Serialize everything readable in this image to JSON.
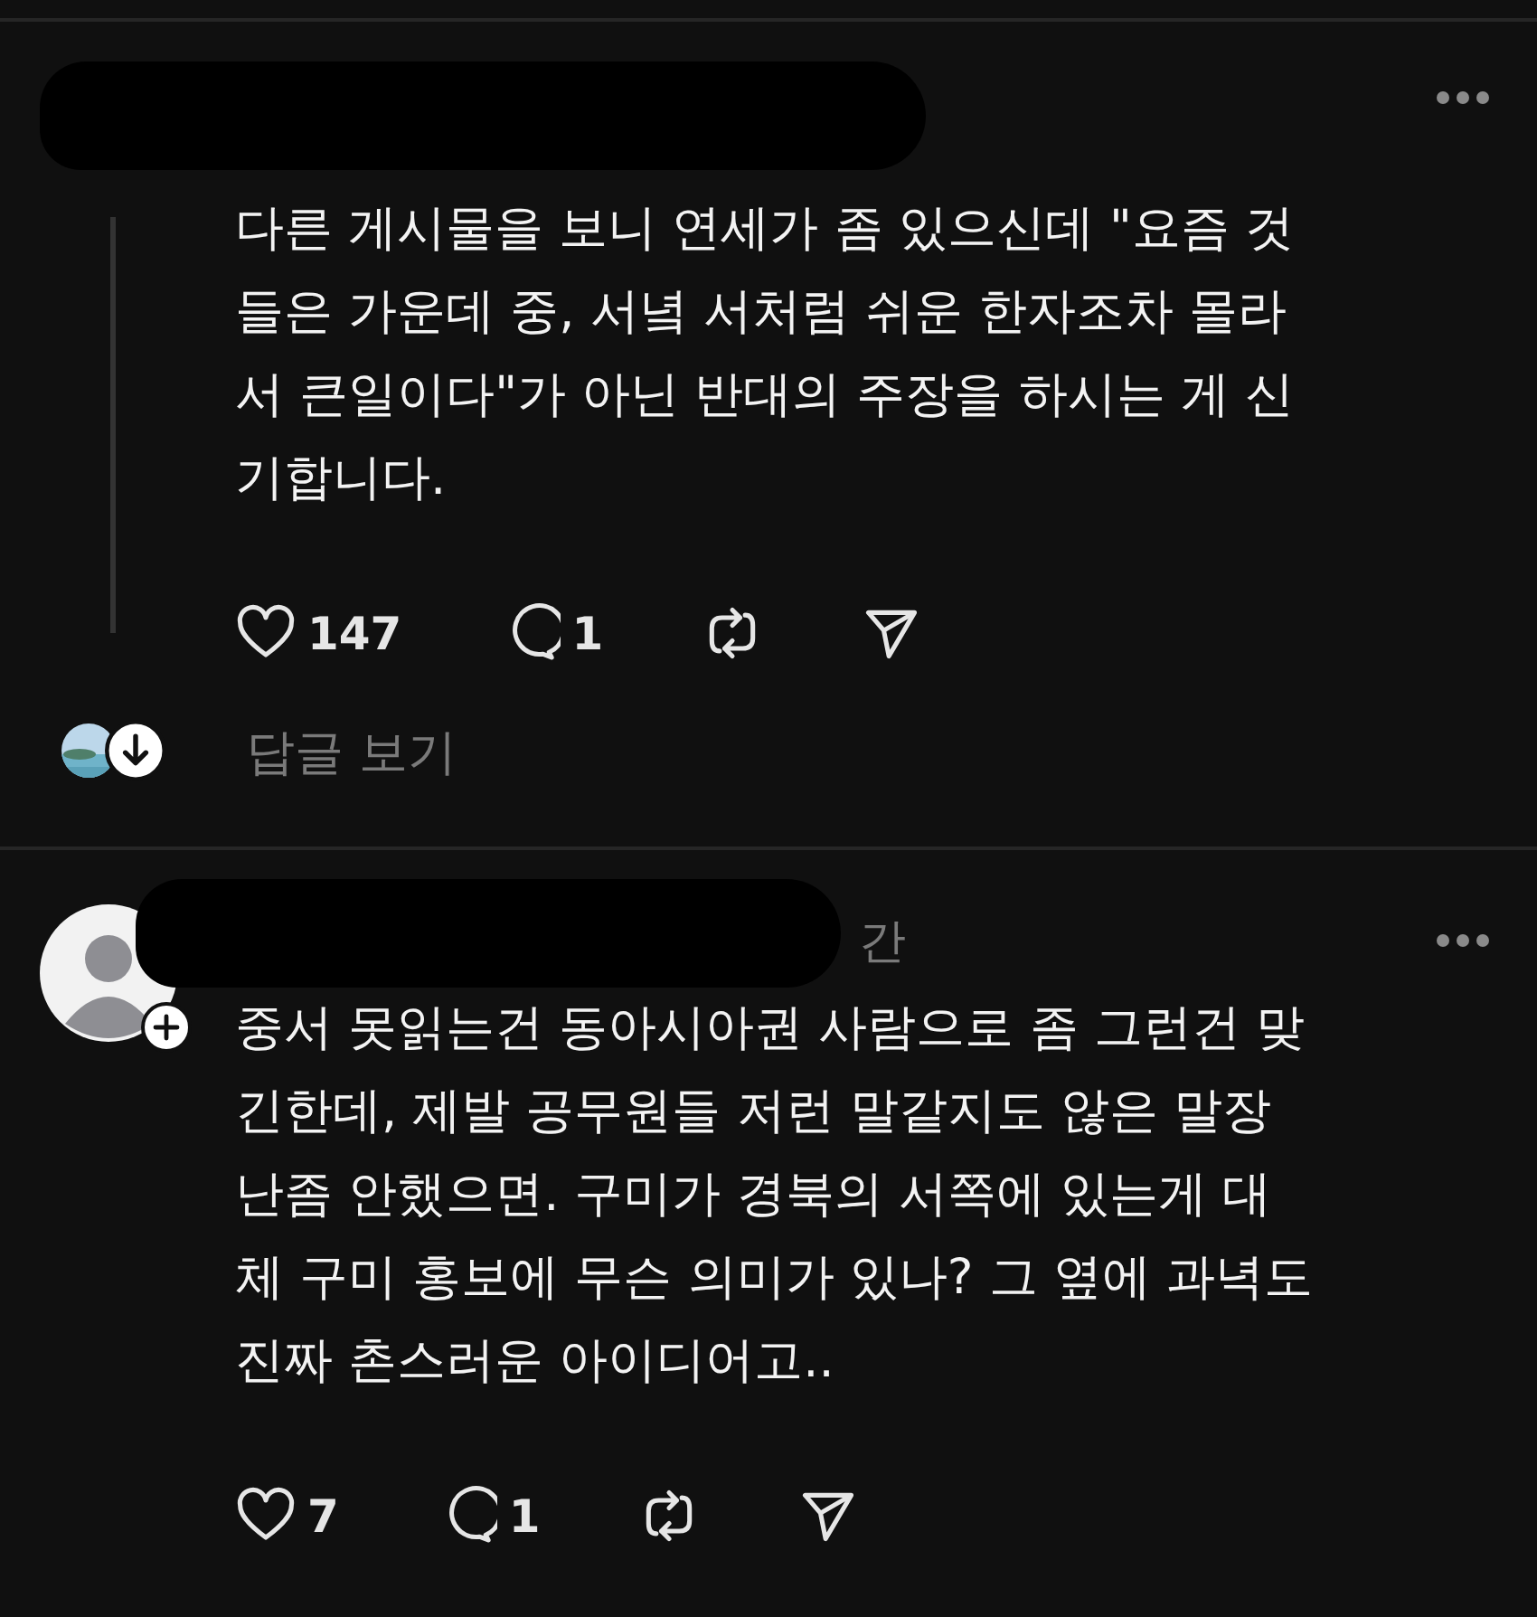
{
  "posts": [
    {
      "redacted": true,
      "lines": [
        "다른 게시물을 보니 연세가 좀 있으신데 \"요즘 것",
        "들은 가운데 중, 서녘 서처럼 쉬운 한자조차 몰라",
        "서 큰일이다\"가 아닌 반대의 주장을 하시는 게 신",
        "기합니다."
      ],
      "likes": "147",
      "replies": "1",
      "view_replies": "답글 보기"
    },
    {
      "redacted": true,
      "avatar": {
        "kind": "default"
      },
      "follow_badge": true,
      "time": "간",
      "lines": [
        "중서 못읽는건 동아시아권 사람으로 좀 그런건 맞",
        "긴한데, 제발 공무원들 저런 말같지도 않은 말장",
        "난좀 안했으면. 구미가 경북의 서쪽에 있는게 대",
        "체 구미 홍보에 무슨 의미가 있나? 그 옆에 과녁도",
        "진짜 촌스러운 아이디어고.."
      ],
      "likes": "7",
      "replies": "1"
    }
  ]
}
